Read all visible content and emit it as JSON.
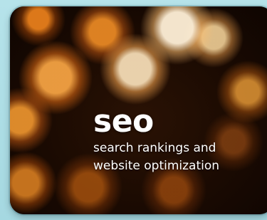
{
  "card": {
    "title": "seo",
    "subtitle_line1": "search rankings and",
    "subtitle_line2": "website optimization"
  },
  "colors": {
    "page_background": "#a9dce4",
    "card_background": "#1a0b02",
    "text": "#ffffff"
  }
}
